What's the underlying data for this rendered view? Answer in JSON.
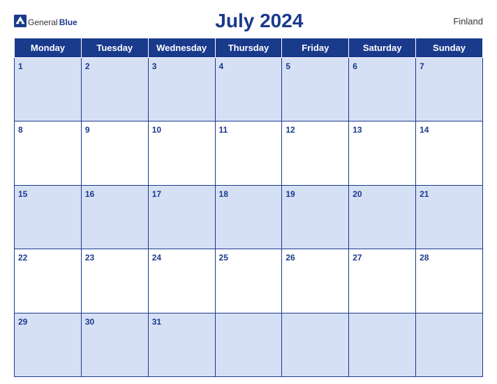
{
  "header": {
    "logo_general": "General",
    "logo_blue": "Blue",
    "title": "July 2024",
    "country": "Finland"
  },
  "weekdays": [
    "Monday",
    "Tuesday",
    "Wednesday",
    "Thursday",
    "Friday",
    "Saturday",
    "Sunday"
  ],
  "weeks": [
    [
      {
        "day": "1",
        "empty": false
      },
      {
        "day": "2",
        "empty": false
      },
      {
        "day": "3",
        "empty": false
      },
      {
        "day": "4",
        "empty": false
      },
      {
        "day": "5",
        "empty": false
      },
      {
        "day": "6",
        "empty": false
      },
      {
        "day": "7",
        "empty": false
      }
    ],
    [
      {
        "day": "8",
        "empty": false
      },
      {
        "day": "9",
        "empty": false
      },
      {
        "day": "10",
        "empty": false
      },
      {
        "day": "11",
        "empty": false
      },
      {
        "day": "12",
        "empty": false
      },
      {
        "day": "13",
        "empty": false
      },
      {
        "day": "14",
        "empty": false
      }
    ],
    [
      {
        "day": "15",
        "empty": false
      },
      {
        "day": "16",
        "empty": false
      },
      {
        "day": "17",
        "empty": false
      },
      {
        "day": "18",
        "empty": false
      },
      {
        "day": "19",
        "empty": false
      },
      {
        "day": "20",
        "empty": false
      },
      {
        "day": "21",
        "empty": false
      }
    ],
    [
      {
        "day": "22",
        "empty": false
      },
      {
        "day": "23",
        "empty": false
      },
      {
        "day": "24",
        "empty": false
      },
      {
        "day": "25",
        "empty": false
      },
      {
        "day": "26",
        "empty": false
      },
      {
        "day": "27",
        "empty": false
      },
      {
        "day": "28",
        "empty": false
      }
    ],
    [
      {
        "day": "29",
        "empty": false
      },
      {
        "day": "30",
        "empty": false
      },
      {
        "day": "31",
        "empty": false
      },
      {
        "day": "",
        "empty": true
      },
      {
        "day": "",
        "empty": true
      },
      {
        "day": "",
        "empty": true
      },
      {
        "day": "",
        "empty": true
      }
    ]
  ]
}
